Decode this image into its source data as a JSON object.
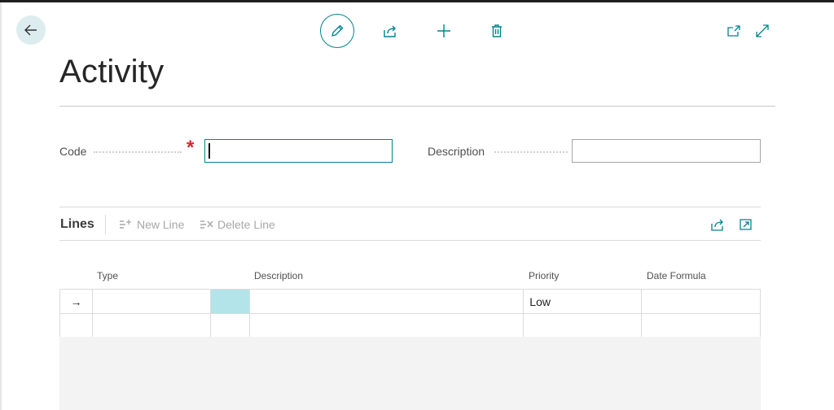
{
  "header": {
    "back_icon": "arrow-left-icon",
    "actions": [
      {
        "name": "edit",
        "icon": "pencil-icon"
      },
      {
        "name": "share",
        "icon": "share-icon"
      },
      {
        "name": "new",
        "icon": "plus-icon"
      },
      {
        "name": "delete",
        "icon": "trash-icon"
      }
    ],
    "right_actions": [
      {
        "name": "open-new-window",
        "icon": "open-window-icon"
      },
      {
        "name": "expand",
        "icon": "expand-icon"
      }
    ]
  },
  "page": {
    "title": "Activity"
  },
  "fields": {
    "code_label": "Code",
    "code_value": "",
    "description_label": "Description",
    "description_value": ""
  },
  "lines": {
    "title": "Lines",
    "new_line": "New Line",
    "delete_line": "Delete Line",
    "columns": [
      "Type",
      "Description",
      "Priority",
      "Date Formula"
    ],
    "rows": [
      {
        "indicator": "→",
        "type": "",
        "description": "",
        "priority": "Low",
        "date_formula": ""
      },
      {
        "indicator": "",
        "type": "",
        "description": "",
        "priority": "",
        "date_formula": ""
      }
    ]
  },
  "colors": {
    "accent": "#00848e",
    "required": "#d9262e",
    "selected_cell": "#b2e4ea"
  }
}
